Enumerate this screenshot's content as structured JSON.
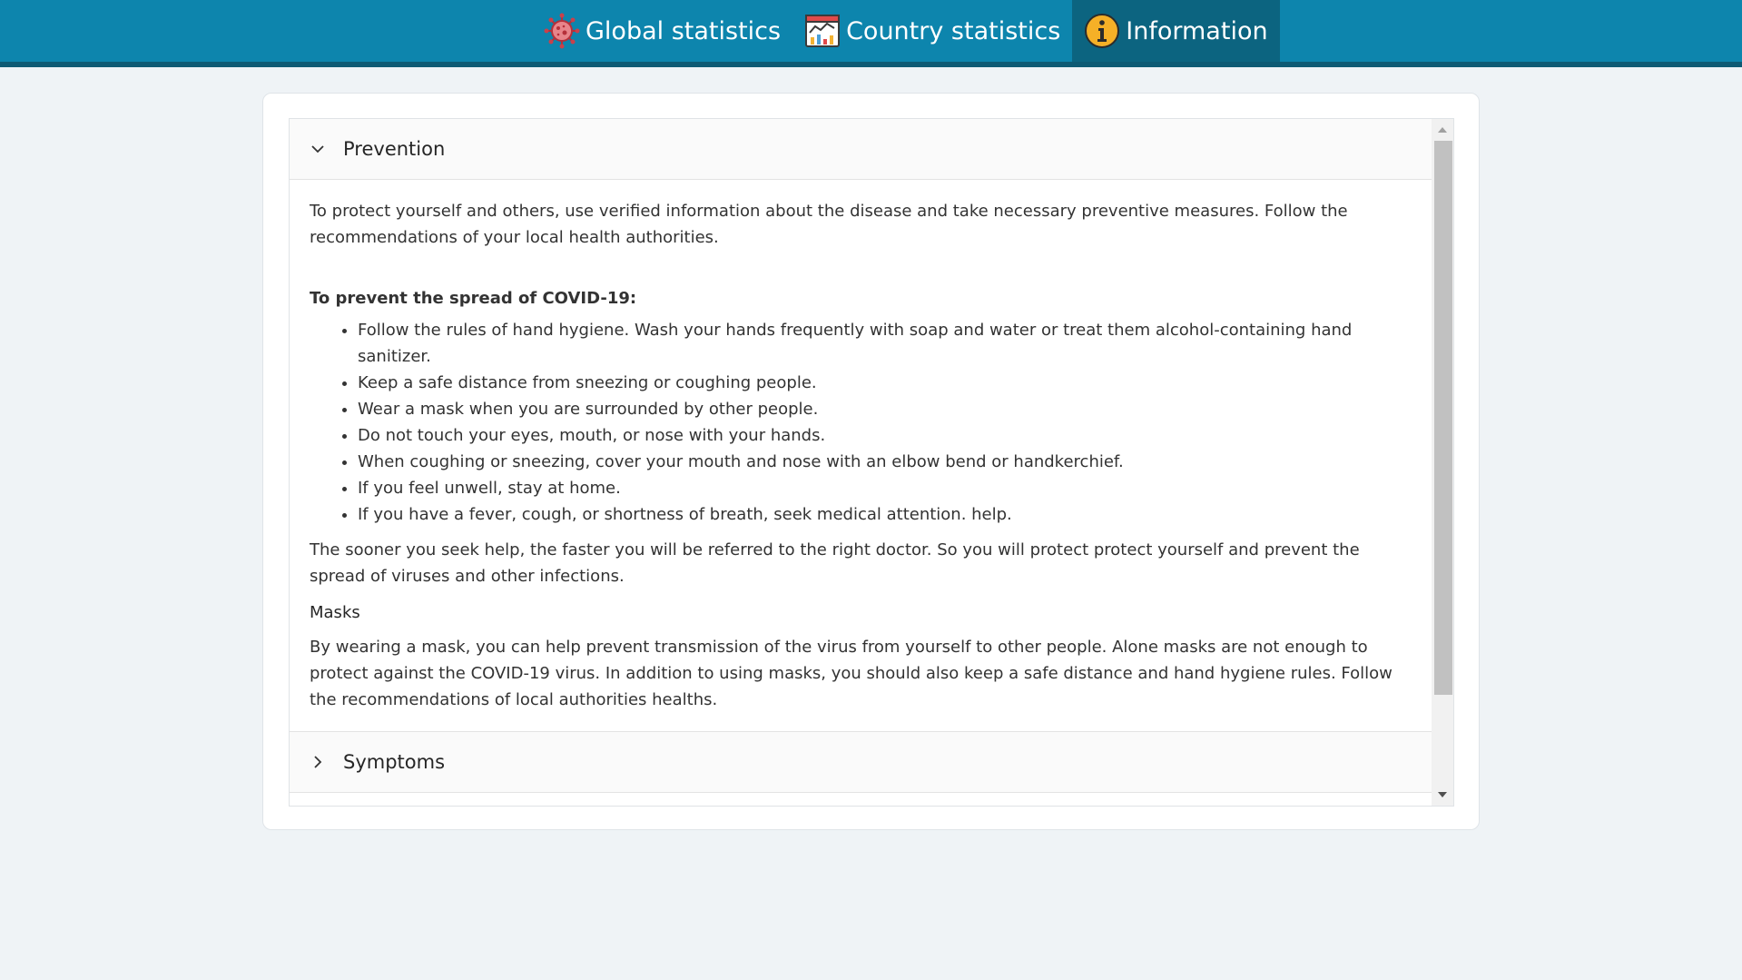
{
  "nav": {
    "items": [
      {
        "label": "Global statistics",
        "icon": "virus-icon",
        "active": false
      },
      {
        "label": "Country statistics",
        "icon": "chart-report-icon",
        "active": false
      },
      {
        "label": "Information",
        "icon": "info-icon",
        "active": true
      }
    ]
  },
  "accordion": {
    "prevention": {
      "title": "Prevention",
      "expanded": true,
      "intro": "To protect yourself and others, use verified information about the disease and take necessary preventive measures. Follow the recommendations of your local health authorities.",
      "subheading": "To prevent the spread of COVID-19:",
      "list": [
        "Follow the rules of hand hygiene. Wash your hands frequently with soap and water or treat them alcohol-containing hand sanitizer.",
        "Keep a safe distance from sneezing or coughing people.",
        "Wear a mask when you are surrounded by other people.",
        "Do not touch your eyes, mouth, or nose with your hands.",
        "When coughing or sneezing, cover your mouth and nose with an elbow bend or handkerchief.",
        "If you feel unwell, stay at home.",
        "If you have a fever, cough, or shortness of breath, seek medical attention. help."
      ],
      "after": "The sooner you seek help, the faster you will be referred to the right doctor. So you will protect protect yourself and prevent the spread of viruses and other infections.",
      "masks_title": "Masks",
      "masks_text": "By wearing a mask, you can help prevent transmission of the virus from yourself to other people. Alone masks are not enough to protect against the COVID-19 virus. In addition to using masks, you should also keep a safe distance and hand hygiene rules. Follow the recommendations of local authorities healths."
    },
    "symptoms": {
      "title": "Symptoms",
      "expanded": false
    }
  },
  "colors": {
    "nav_bg": "#0d85ad",
    "nav_active": "#0c6480",
    "nav_border": "#0e5a74",
    "page_bg": "#eff3f6"
  }
}
